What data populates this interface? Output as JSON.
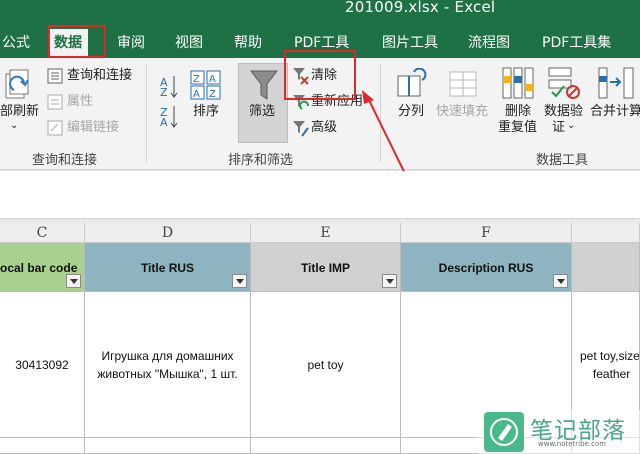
{
  "window": {
    "title": "201009.xlsx  -  Excel"
  },
  "tabs": [
    {
      "id": "formulas",
      "label": "公式"
    },
    {
      "id": "data",
      "label": "数据",
      "active": true
    },
    {
      "id": "review",
      "label": "审阅"
    },
    {
      "id": "view",
      "label": "视图"
    },
    {
      "id": "help",
      "label": "帮助"
    },
    {
      "id": "pdf-tools",
      "label": "PDF工具"
    },
    {
      "id": "image-tools",
      "label": "图片工具"
    },
    {
      "id": "flowchart",
      "label": "流程图"
    },
    {
      "id": "pdf-toolset",
      "label": "PDF工具集"
    }
  ],
  "ribbon": {
    "queries": {
      "refresh_all": "部刷新",
      "queries_connections": "查询和连接",
      "properties": "属性",
      "edit_links": "编辑链接",
      "group_label": "查询和连接"
    },
    "sort_filter": {
      "sort": "排序",
      "filter": "筛选",
      "clear": "清除",
      "reapply": "重新应用",
      "advanced": "高级",
      "group_label": "排序和筛选"
    },
    "data_tools": {
      "text_to_columns": "分列",
      "flash_fill": "快速填充",
      "remove_duplicates_1": "删除",
      "remove_duplicates_2": "重复值",
      "data_validation_1": "数据验",
      "data_validation_2": "证",
      "consolidate": "合并计算",
      "group_label": "数据工具"
    }
  },
  "grid": {
    "columns": [
      "C",
      "D",
      "E",
      "F"
    ],
    "headers": [
      "ocal bar code",
      "Title RUS",
      "Title IMP",
      "Description RUS"
    ],
    "row": {
      "c": "30413092",
      "d": "Игрушка для домашних животных \"Мышка\", 1 шт.",
      "e": "pet toy",
      "g": "pet toy,size:\nfeather"
    }
  },
  "watermark": {
    "main": "笔记部落",
    "sub": "www.notetribe.com"
  },
  "colors": {
    "excel_green": "#1e7145",
    "header_fill_green": "#a9d08e",
    "header_fill_blue": "#8eb4c1",
    "header_fill_gray": "#d0d0d0",
    "annotation_red": "#e0282a"
  }
}
